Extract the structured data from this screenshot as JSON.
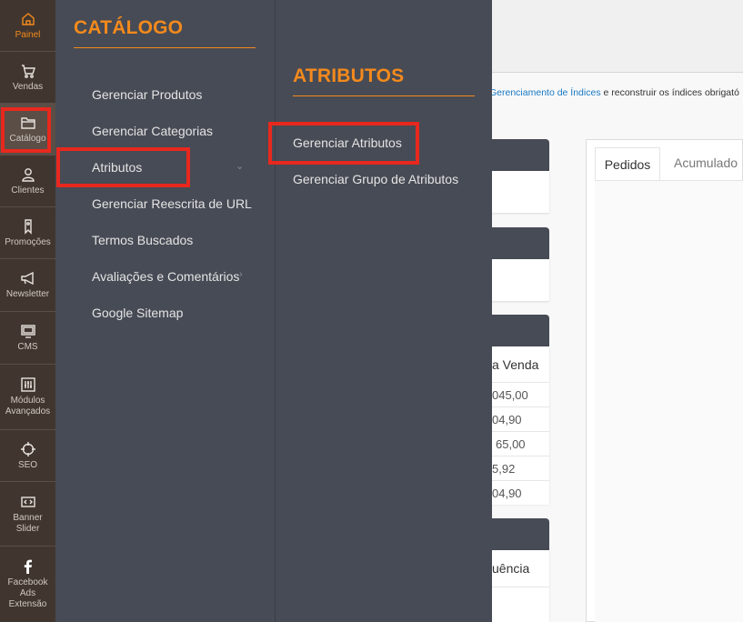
{
  "sidebar": {
    "items": [
      {
        "label": "Painel",
        "icon": "home-icon"
      },
      {
        "label": "Vendas",
        "icon": "cart-icon"
      },
      {
        "label": "Catálogo",
        "icon": "folder-icon"
      },
      {
        "label": "Clientes",
        "icon": "user-icon"
      },
      {
        "label": "Promoções",
        "icon": "tag-icon"
      },
      {
        "label": "Newsletter",
        "icon": "megaphone-icon"
      },
      {
        "label": "CMS",
        "icon": "monitor-icon"
      },
      {
        "label": "Módulos Avançados",
        "icon": "sliders-icon"
      },
      {
        "label": "SEO",
        "icon": "crosshair-icon"
      },
      {
        "label": "Banner Slider",
        "icon": "code-icon"
      },
      {
        "label": "Facebook Ads Extensão",
        "icon": "facebook-icon"
      }
    ]
  },
  "catalog_menu": {
    "title": "CATÁLOGO",
    "items": [
      "Gerenciar Produtos",
      "Gerenciar Categorias",
      "Atributos",
      "Gerenciar Reescrita de URL",
      "Termos Buscados",
      "Avaliações e Comentários",
      "Google Sitemap"
    ]
  },
  "attributes_menu": {
    "title": "ATRIBUTOS",
    "items": [
      "Gerenciar Atributos",
      "Gerenciar Grupo de Atributos"
    ]
  },
  "background": {
    "notice_link": "Gerenciamento de Índices",
    "notice_text": " e reconstruir os índices obrigató",
    "table_header_1": "a Venda",
    "table_values": [
      "045,00",
      "04,90",
      "65,00",
      "5,92",
      "04,90"
    ],
    "table_header_2": "uência",
    "tabs": [
      "Pedidos",
      "Acumulado"
    ]
  },
  "colors": {
    "accent": "#f48a1c",
    "highlight": "#e8281e",
    "sidebar_bg": "#41362f",
    "panel_bg": "#474b55",
    "link": "#1979c3"
  }
}
